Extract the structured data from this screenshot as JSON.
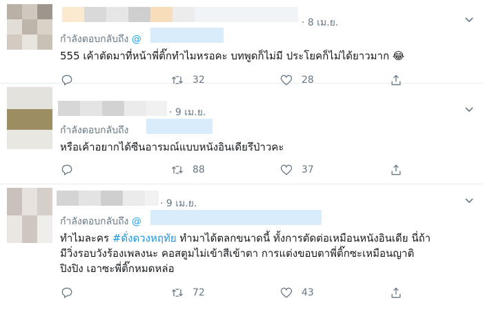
{
  "tweets": [
    {
      "date": "· 8 เม.ย.",
      "reply_prefix": "กำลังตอบกลับถึง",
      "reply_handle": "@",
      "text": "555 เค้าตัดมาที่หน้าพี่ติ๊กทำไมหรอคะ บทพูดก็ไม่มี ประโยคก็ไม่ได้ยาวมาก 😂",
      "retweets": "32",
      "likes": "28"
    },
    {
      "date": "· 9 เม.ย.",
      "reply_prefix": "กำลังตอบกลับถึง",
      "reply_handle": "",
      "text": "หรือเค้าอยากได้ซีนอารมณ์แบบหนังอินเดียรึป่าวคะ",
      "retweets": "88",
      "likes": "37"
    },
    {
      "date": "· 9 เม.ย.",
      "reply_prefix": "กำลังตอบกลับถึง",
      "reply_handle": "@",
      "text_line1_a": "ทำไมละคร ",
      "hashtag": "#ดั่งดวงหฤทัย",
      "text_line1_b": " ทำมาได้ตลกขนาดนี้ ทั้งการตัดต่อเหมือนหนังอินเดีย นี่ถ้า",
      "text_line2": "มีวิ่งรอบวังร้องเพลงนะ คอสตูมไม่เข้าสีเข้าตา การแต่งขอบตาพี่ติ๊กซะเหมือนญาติ",
      "text_line3": "ปิงปิง เอาซะพี่ติ๊กหมดหล่อ",
      "retweets": "72",
      "likes": "43"
    }
  ],
  "icons": [
    "reply-icon",
    "retweet-icon",
    "like-icon",
    "share-icon",
    "chevron-down-icon"
  ],
  "colors": {
    "muted": "#657786",
    "link": "#1da1f2",
    "text": "#14171a",
    "divider": "#e6ecf0"
  }
}
